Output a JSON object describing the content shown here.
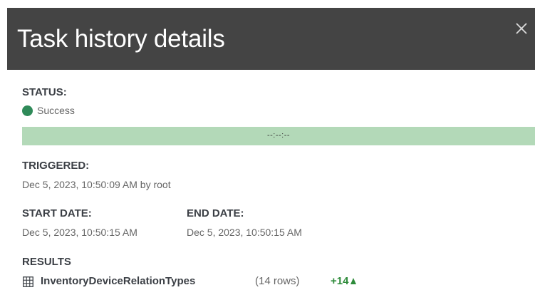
{
  "header": {
    "title": "Task history details",
    "close_icon": "close-icon"
  },
  "status": {
    "label": "STATUS:",
    "value": "Success",
    "color": "#2f8a59"
  },
  "progress": {
    "text": "--:--:--",
    "color": "#b3d9b8"
  },
  "triggered": {
    "label": "TRIGGERED:",
    "value": "Dec 5, 2023, 10:50:09 AM by root"
  },
  "start_date": {
    "label": "START DATE:",
    "value": "Dec 5, 2023, 10:50:15 AM"
  },
  "end_date": {
    "label": "END DATE:",
    "value": "Dec 5, 2023, 10:50:15 AM"
  },
  "results": {
    "label": "RESULTS",
    "items": [
      {
        "icon": "table-icon",
        "name": "InventoryDeviceRelationTypes",
        "rows": "(14 rows)",
        "diff": "+14",
        "diff_icon": "up-arrow-icon",
        "diff_color": "#2e8b3a"
      }
    ]
  }
}
